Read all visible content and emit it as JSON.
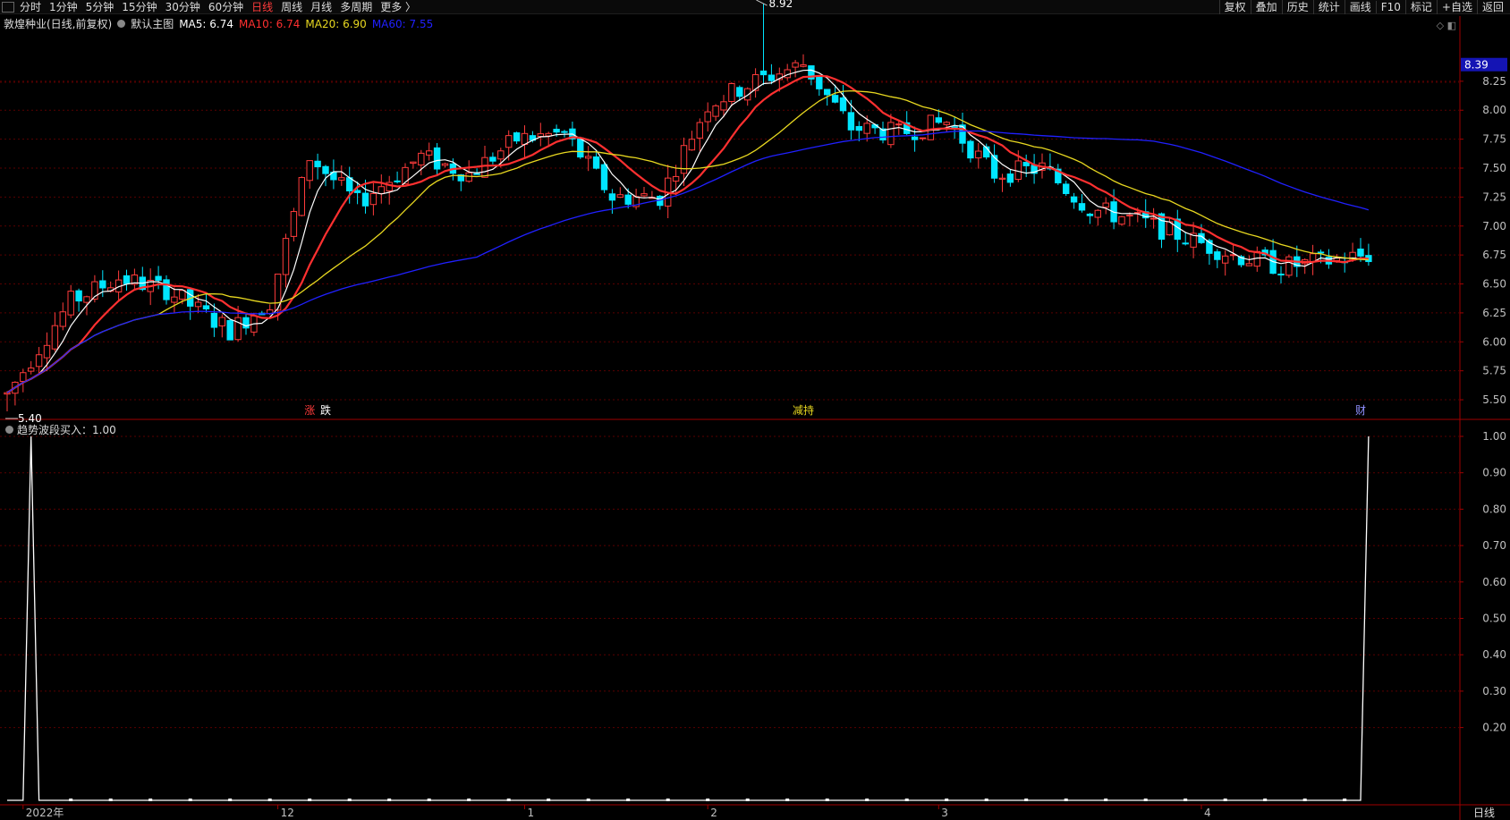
{
  "period_tabs": [
    {
      "label": "分时",
      "active": false
    },
    {
      "label": "1分钟",
      "active": false
    },
    {
      "label": "5分钟",
      "active": false
    },
    {
      "label": "15分钟",
      "active": false
    },
    {
      "label": "30分钟",
      "active": false
    },
    {
      "label": "60分钟",
      "active": false
    },
    {
      "label": "日线",
      "active": true
    },
    {
      "label": "周线",
      "active": false
    },
    {
      "label": "月线",
      "active": false
    },
    {
      "label": "多周期",
      "active": false
    },
    {
      "label": "更多 〉",
      "active": false
    }
  ],
  "right_tools": [
    "复权",
    "叠加",
    "历史",
    "统计",
    "画线",
    "F10",
    "标记",
    "+自选",
    "返回"
  ],
  "stock_title": "敦煌种业(日线,前复权)",
  "main_chart_label": "默认主图",
  "ma_labels": [
    {
      "text": "MA5: 6.74",
      "color": "#ffffff"
    },
    {
      "text": "MA10: 6.74",
      "color": "#ff3030"
    },
    {
      "text": "MA20: 6.90",
      "color": "#e8d820"
    },
    {
      "text": "MA60: 7.55",
      "color": "#2020ff"
    }
  ],
  "indicator_title": "趋势波段买入：1.00",
  "colors": {
    "up": "#ff3b3b",
    "down": "#00e5ff",
    "grid": "#5a0000",
    "axis": "#a00000"
  },
  "corner_icons": "◇ ◧",
  "bottom_right_label": "日线",
  "chart_data": {
    "type": "candlestick",
    "price_axis_ticks": [
      "8.25",
      "8.00",
      "7.75",
      "7.50",
      "7.25",
      "7.00",
      "6.75",
      "6.50",
      "6.25",
      "6.00",
      "5.75",
      "5.50"
    ],
    "price_ylim": [
      5.4,
      8.55
    ],
    "current_price_label": "8.39",
    "high_marker": "8.92",
    "low_marker": "5.40",
    "event_markers": [
      {
        "label": "涨",
        "index": 38,
        "color": "#ff3b3b"
      },
      {
        "label": "跌",
        "index": 40,
        "color": "#ffffff"
      },
      {
        "label": "减持",
        "index": 100,
        "color": "#e8d820"
      },
      {
        "label": "财",
        "index": 170,
        "color": "#9090ff"
      }
    ],
    "x_axis_labels": [
      {
        "label": "2022年",
        "index": 2
      },
      {
        "label": "12",
        "index": 34
      },
      {
        "label": "1",
        "index": 65
      },
      {
        "label": "2",
        "index": 88
      },
      {
        "label": "3",
        "index": 117
      },
      {
        "label": "4",
        "index": 150
      }
    ],
    "ma_series": [
      {
        "name": "MA5",
        "color": "#ffffff",
        "width": 1.2
      },
      {
        "name": "MA10",
        "color": "#ff3030",
        "width": 2.2
      },
      {
        "name": "MA20",
        "color": "#e8d820",
        "width": 1.3
      },
      {
        "name": "MA60",
        "color": "#2020ff",
        "width": 1.3
      }
    ],
    "indicator": {
      "name": "趋势波段买入",
      "value": "1.00",
      "axis_ticks": [
        "1.00",
        "0.90",
        "0.80",
        "0.70",
        "0.60",
        "0.50",
        "0.40",
        "0.30",
        "0.20"
      ],
      "ylim": [
        0,
        1.0
      ],
      "signal_indices": [
        3,
        171
      ]
    }
  }
}
